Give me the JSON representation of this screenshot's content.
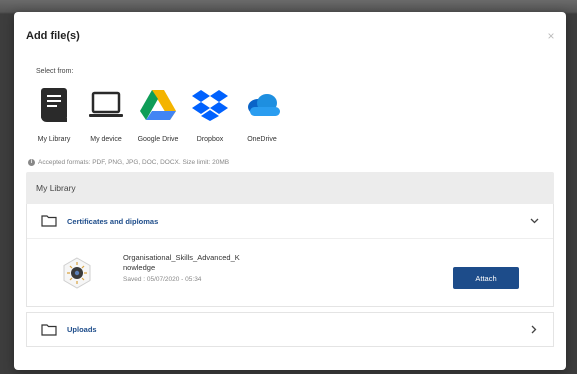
{
  "dialog": {
    "title": "Add file(s)",
    "close_symbol": "×"
  },
  "sources": {
    "heading": "Select from:",
    "items": [
      {
        "label": "My Library",
        "icon": "library-book-icon"
      },
      {
        "label": "My device",
        "icon": "laptop-icon"
      },
      {
        "label": "Google Drive",
        "icon": "google-drive-icon"
      },
      {
        "label": "Dropbox",
        "icon": "dropbox-icon"
      },
      {
        "label": "OneDrive",
        "icon": "onedrive-icon"
      }
    ]
  },
  "formats_note": "Accepted formats: PDF, PNG, JPG, DOC, DOCX. Size limit: 20MB",
  "library": {
    "header": "My Library",
    "folders": [
      {
        "label": "Certificates and diplomas",
        "expanded": true,
        "files": [
          {
            "name": "Organisational_Skills_Advanced_Knowledge",
            "meta": "Saved : 05/07/2020 - 05:34",
            "action_label": "Attach"
          }
        ]
      },
      {
        "label": "Uploads",
        "expanded": false
      }
    ]
  },
  "colors": {
    "accent": "#1d4c8a",
    "google_green": "#0f9d58",
    "google_yellow": "#f4b400",
    "google_blue": "#4285f4",
    "dropbox_blue": "#0061fe",
    "onedrive_blue": "#0a64c8"
  }
}
